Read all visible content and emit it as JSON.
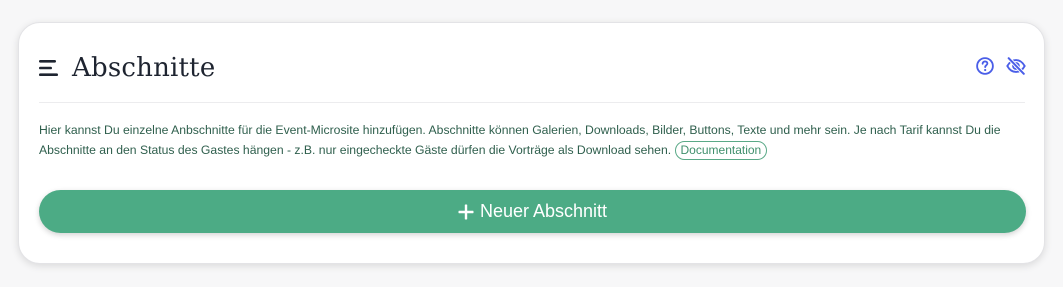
{
  "section": {
    "title": "Abschnitte",
    "description": "Hier kannst Du einzelne Anbschnitte für die Event-Microsite hinzufügen. Abschnitte können Galerien, Downloads, Bilder, Buttons, Texte und mehr sein. Je nach Tarif kannst Du die Abschnitte an den Status des Gastes hängen - z.B. nur eingecheckte Gäste dürfen die Vorträge als Download sehen.",
    "doc_link_label": "Documentation",
    "add_button_label": "Neuer Abschnitt"
  },
  "icons": {
    "menu": "menu-lines-icon",
    "help": "question-circle-icon",
    "visibility": "eye-slash-icon",
    "add": "plus-icon"
  },
  "colors": {
    "accent_green": "#4cab85",
    "text_green": "#2f5f4d",
    "icon_blue": "#4a5ee8",
    "title_dark": "#1e2430"
  }
}
